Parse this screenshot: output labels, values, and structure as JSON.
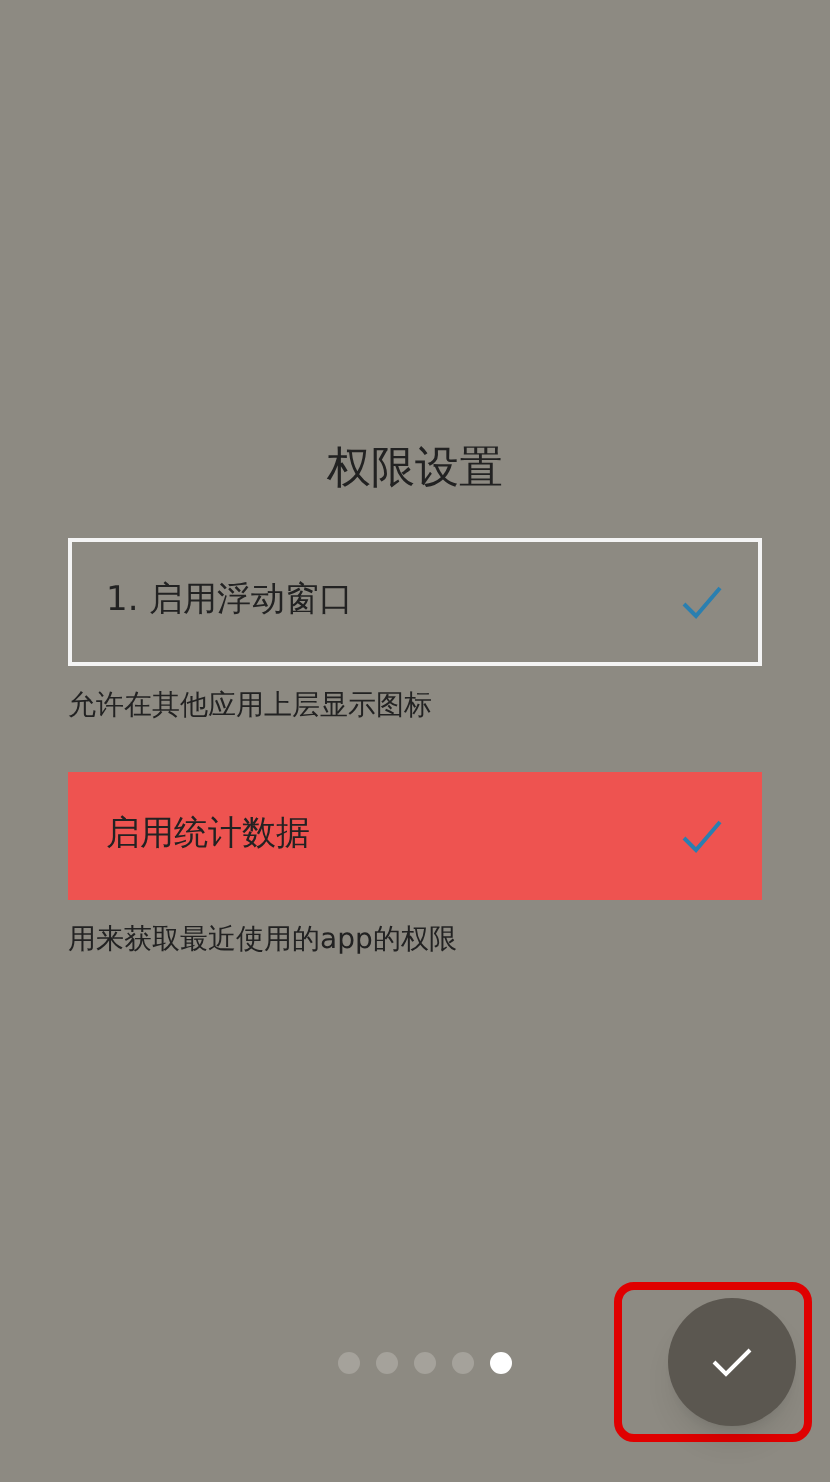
{
  "title": "权限设置",
  "permissions": [
    {
      "kind": "outlined",
      "label": "1. 启用浮动窗口",
      "checked": true,
      "description": "允许在其他应用上层显示图标"
    },
    {
      "kind": "filled",
      "label": "启用统计数据",
      "checked": true,
      "description": "用来获取最近使用的app的权限"
    }
  ],
  "pages": [
    {
      "selected": false
    },
    {
      "selected": false
    },
    {
      "selected": false
    },
    {
      "selected": false
    },
    {
      "selected": true
    }
  ]
}
